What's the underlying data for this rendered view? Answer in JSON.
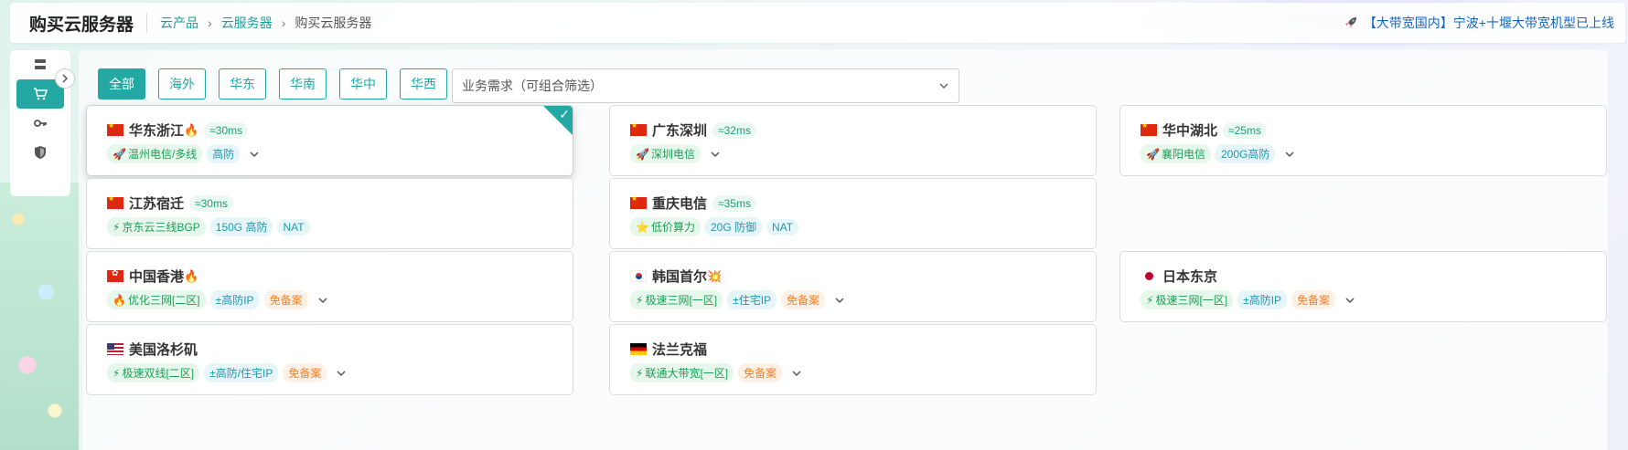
{
  "header": {
    "title": "购买云服务器",
    "breadcrumb": [
      "云产品",
      "云服务器",
      "购买云服务器"
    ],
    "notice": "【大带宽国内】宁波+十堰大带宽机型已上线"
  },
  "sidebar": {
    "items": [
      {
        "icon": "server-list-icon",
        "active": false
      },
      {
        "icon": "cart-icon",
        "active": true
      },
      {
        "icon": "key-icon",
        "active": false
      },
      {
        "icon": "shield-icon",
        "active": false
      }
    ]
  },
  "filters": {
    "regions": [
      "全部",
      "海外",
      "华东",
      "华南",
      "华中",
      "华西"
    ],
    "active": "全部",
    "business_select_placeholder": "业务需求（可组合筛选）"
  },
  "cards": [
    {
      "name": "华东浙江",
      "flag": "cn",
      "fire": true,
      "latency": "≈30ms",
      "selected": true,
      "tags": [
        {
          "text": "温州电信/多线",
          "color": "green",
          "icon": "rocket"
        },
        {
          "text": "高防",
          "color": "teal"
        }
      ],
      "expandable": true
    },
    {
      "name": "广东深圳",
      "flag": "cn",
      "latency": "≈32ms",
      "tags": [
        {
          "text": "深圳电信",
          "color": "green",
          "icon": "rocket"
        }
      ],
      "expandable": true
    },
    {
      "name": "华中湖北",
      "flag": "cn",
      "latency": "≈25ms",
      "tags": [
        {
          "text": "襄阳电信",
          "color": "green",
          "icon": "rocket"
        },
        {
          "text": "200G高防",
          "color": "teal"
        }
      ],
      "expandable": true
    },
    {
      "name": "江苏宿迁",
      "flag": "cn",
      "latency": "≈30ms",
      "tags": [
        {
          "text": "京东云三线BGP",
          "color": "green",
          "icon": "bolt"
        },
        {
          "text": "150G 高防",
          "color": "teal"
        },
        {
          "text": "NAT",
          "color": "teal"
        }
      ],
      "expandable": false
    },
    {
      "name": "重庆电信",
      "flag": "cn",
      "latency": "≈35ms",
      "tags": [
        {
          "text": "低价算力",
          "color": "green",
          "icon": "star"
        },
        {
          "text": "20G 防御",
          "color": "teal"
        },
        {
          "text": "NAT",
          "color": "teal"
        }
      ],
      "expandable": false
    },
    {
      "name": "中国香港",
      "flag": "hk",
      "fire": true,
      "tags": [
        {
          "text": "优化三网[二区]",
          "color": "green",
          "icon": "fire"
        },
        {
          "text": "±高防IP",
          "color": "teal"
        },
        {
          "text": "免备案",
          "color": "orange"
        }
      ],
      "expandable": true
    },
    {
      "name": "韩国首尔",
      "flag": "kr",
      "burst": true,
      "tags": [
        {
          "text": "极速三网[一区]",
          "color": "green",
          "icon": "bolt"
        },
        {
          "text": "±住宅IP",
          "color": "teal"
        },
        {
          "text": "免备案",
          "color": "orange"
        }
      ],
      "expandable": true
    },
    {
      "name": "日本东京",
      "flag": "jp",
      "tags": [
        {
          "text": "极速三网[一区]",
          "color": "green",
          "icon": "bolt"
        },
        {
          "text": "±高防IP",
          "color": "teal"
        },
        {
          "text": "免备案",
          "color": "orange"
        }
      ],
      "expandable": true
    },
    {
      "name": "美国洛杉矶",
      "flag": "us",
      "tags": [
        {
          "text": "极速双线[二区]",
          "color": "green",
          "icon": "bolt"
        },
        {
          "text": "±高防/住宅IP",
          "color": "teal"
        },
        {
          "text": "免备案",
          "color": "orange"
        }
      ],
      "expandable": true
    },
    {
      "name": "法兰克福",
      "flag": "de",
      "tags": [
        {
          "text": "联通大带宽[一区]",
          "color": "green",
          "icon": "bolt"
        },
        {
          "text": "免备案",
          "color": "orange"
        }
      ],
      "expandable": true
    }
  ],
  "colors": {
    "accent": "#23a8a4",
    "link": "#1565c0"
  }
}
